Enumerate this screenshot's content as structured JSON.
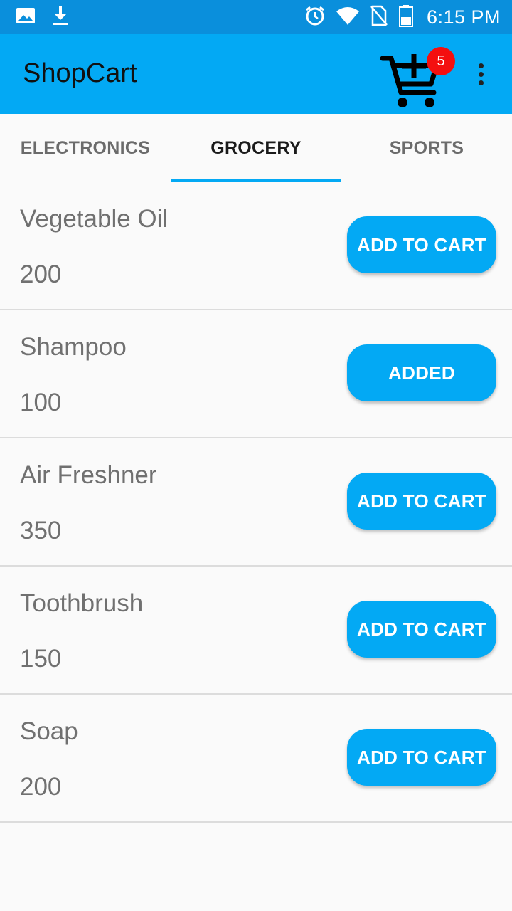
{
  "status_bar": {
    "time": "6:15 PM",
    "icons": [
      "image-icon",
      "download-icon",
      "alarm-icon",
      "wifi-icon",
      "no-sim-icon",
      "battery-icon"
    ]
  },
  "app_bar": {
    "title": "ShopCart",
    "cart_count": "5",
    "cart_icon": "add-shopping-cart-icon",
    "overflow_icon": "more-vert-icon",
    "background": "#03a9f4",
    "badge_color": "#f40f0f"
  },
  "tabs": [
    {
      "label": "ELECTRONICS",
      "active": false
    },
    {
      "label": "GROCERY",
      "active": true
    },
    {
      "label": "SPORTS",
      "active": false
    }
  ],
  "products": [
    {
      "name": "Vegetable Oil",
      "price": "200",
      "button": "ADD TO CART"
    },
    {
      "name": "Shampoo",
      "price": "100",
      "button": "ADDED"
    },
    {
      "name": "Air Freshner",
      "price": "350",
      "button": "ADD TO CART"
    },
    {
      "name": "Toothbrush",
      "price": "150",
      "button": "ADD TO CART"
    },
    {
      "name": "Soap",
      "price": "200",
      "button": "ADD TO CART"
    }
  ]
}
